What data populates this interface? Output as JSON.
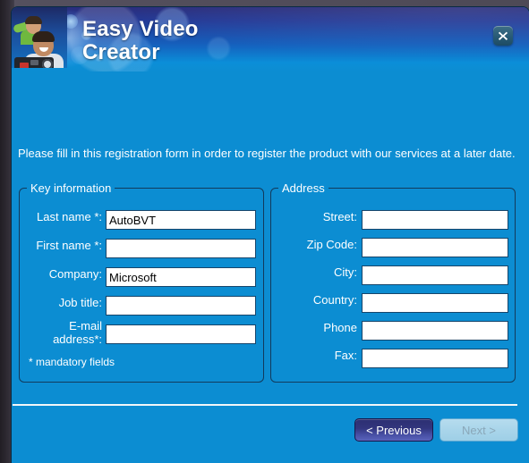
{
  "window": {
    "app_title": "Easy Video\nCreator",
    "close_label": "X",
    "close_icon": "close-icon"
  },
  "intro": {
    "text": "Please fill in this registration form in order to register the product with our services at a later date."
  },
  "key_information": {
    "legend": "Key information",
    "fields": [
      {
        "label": "Last name *:",
        "value": "AutoBVT",
        "placeholder": ""
      },
      {
        "label": "First name *:",
        "value": "",
        "placeholder": ""
      },
      {
        "label": "Company:",
        "value": "Microsoft",
        "placeholder": ""
      },
      {
        "label": "Job title:",
        "value": "",
        "placeholder": ""
      },
      {
        "label": "E-mail\naddress*:",
        "value": "",
        "placeholder": ""
      }
    ],
    "mandatory_note": "* mandatory fields"
  },
  "address": {
    "legend": "Address",
    "fields": [
      {
        "label": "Street:",
        "value": "",
        "placeholder": ""
      },
      {
        "label": "Zip Code:",
        "value": "",
        "placeholder": ""
      },
      {
        "label": "City:",
        "value": "",
        "placeholder": ""
      },
      {
        "label": "Country:",
        "value": "",
        "placeholder": ""
      },
      {
        "label": "Phone",
        "value": "",
        "placeholder": ""
      },
      {
        "label": "Fax:",
        "value": "",
        "placeholder": ""
      }
    ]
  },
  "footer": {
    "previous_label": "< Previous",
    "next_label": "Next >"
  },
  "colors": {
    "body_blue": "#0c8dd2",
    "header_top": "#2a2d7c",
    "header_bottom": "#0b8ed8",
    "previous_button": "#32357d",
    "next_button_disabled": "#a9d5ea",
    "input_background": "#ffffff",
    "groupbox_border": "#123a5c"
  }
}
